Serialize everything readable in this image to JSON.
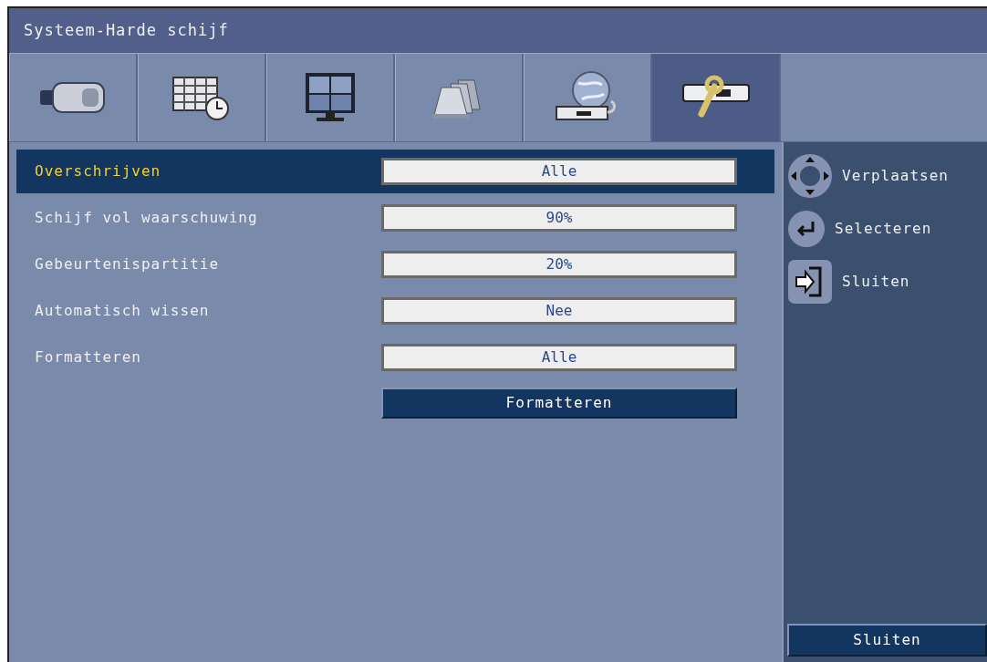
{
  "window": {
    "title": "Systeem-Harde schijf"
  },
  "tabs": [
    {
      "kind": "camera",
      "selected": false
    },
    {
      "kind": "schedule",
      "selected": false
    },
    {
      "kind": "monitor",
      "selected": false
    },
    {
      "kind": "alarm",
      "selected": false
    },
    {
      "kind": "network",
      "selected": false
    },
    {
      "kind": "system",
      "selected": true
    }
  ],
  "settings": [
    {
      "label": "Overschrijven",
      "value": "Alle",
      "selected": true
    },
    {
      "label": "Schijf vol waarschuwing",
      "value": "90%",
      "selected": false
    },
    {
      "label": "Gebeurtenispartitie",
      "value": "20%",
      "selected": false
    },
    {
      "label": "Automatisch wissen",
      "value": "Nee",
      "selected": false
    },
    {
      "label": "Formatteren",
      "value": "Alle",
      "selected": false
    }
  ],
  "action_button": "Formatteren",
  "legend": [
    {
      "kind": "move",
      "label": "Verplaatsen"
    },
    {
      "kind": "select",
      "label": "Selecteren"
    },
    {
      "kind": "exit",
      "label": "Sluiten"
    }
  ],
  "close_button": "Sluiten"
}
